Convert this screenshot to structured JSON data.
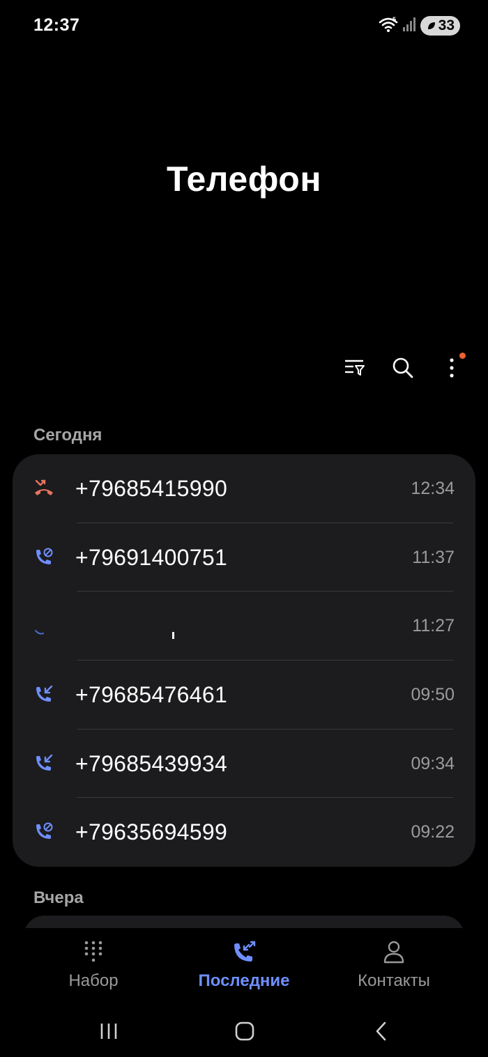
{
  "status_bar": {
    "time": "12:37",
    "battery": "33",
    "icons": [
      "wifi-icon",
      "signal-icon",
      "battery-saver-icon"
    ]
  },
  "title": "Телефон",
  "toolbar": {
    "icons": [
      "filter-icon",
      "search-icon",
      "more-options-icon"
    ],
    "notification_dot_color": "#e8632f"
  },
  "sections": [
    {
      "header": "Сегодня",
      "calls": [
        {
          "type": "missed",
          "icon": "missed-call-icon",
          "number": "+79685415990",
          "time": "12:34"
        },
        {
          "type": "blocked",
          "icon": "blocked-call-icon",
          "number": "+79691400751",
          "time": "11:37"
        },
        {
          "type": "redacted",
          "icon": "",
          "number": "",
          "time": "11:27"
        },
        {
          "type": "incoming",
          "icon": "incoming-call-icon",
          "number": "+79685476461",
          "time": "09:50"
        },
        {
          "type": "incoming",
          "icon": "incoming-call-icon",
          "number": "+79685439934",
          "time": "09:34"
        },
        {
          "type": "blocked",
          "icon": "blocked-call-icon",
          "number": "+79635694599",
          "time": "09:22"
        }
      ]
    },
    {
      "header": "Вчера",
      "calls": []
    }
  ],
  "bottom_nav": [
    {
      "label": "Набор",
      "icon": "keypad-icon",
      "active": false
    },
    {
      "label": "Последние",
      "icon": "recents-icon",
      "active": true
    },
    {
      "label": "Контакты",
      "icon": "contacts-icon",
      "active": false
    }
  ],
  "colors": {
    "background": "#000000",
    "card": "#1c1c1e",
    "accent": "#6f8fff",
    "missed": "#e8735f",
    "incoming": "#6f8fff",
    "secondary_text": "#9b9b9b"
  }
}
